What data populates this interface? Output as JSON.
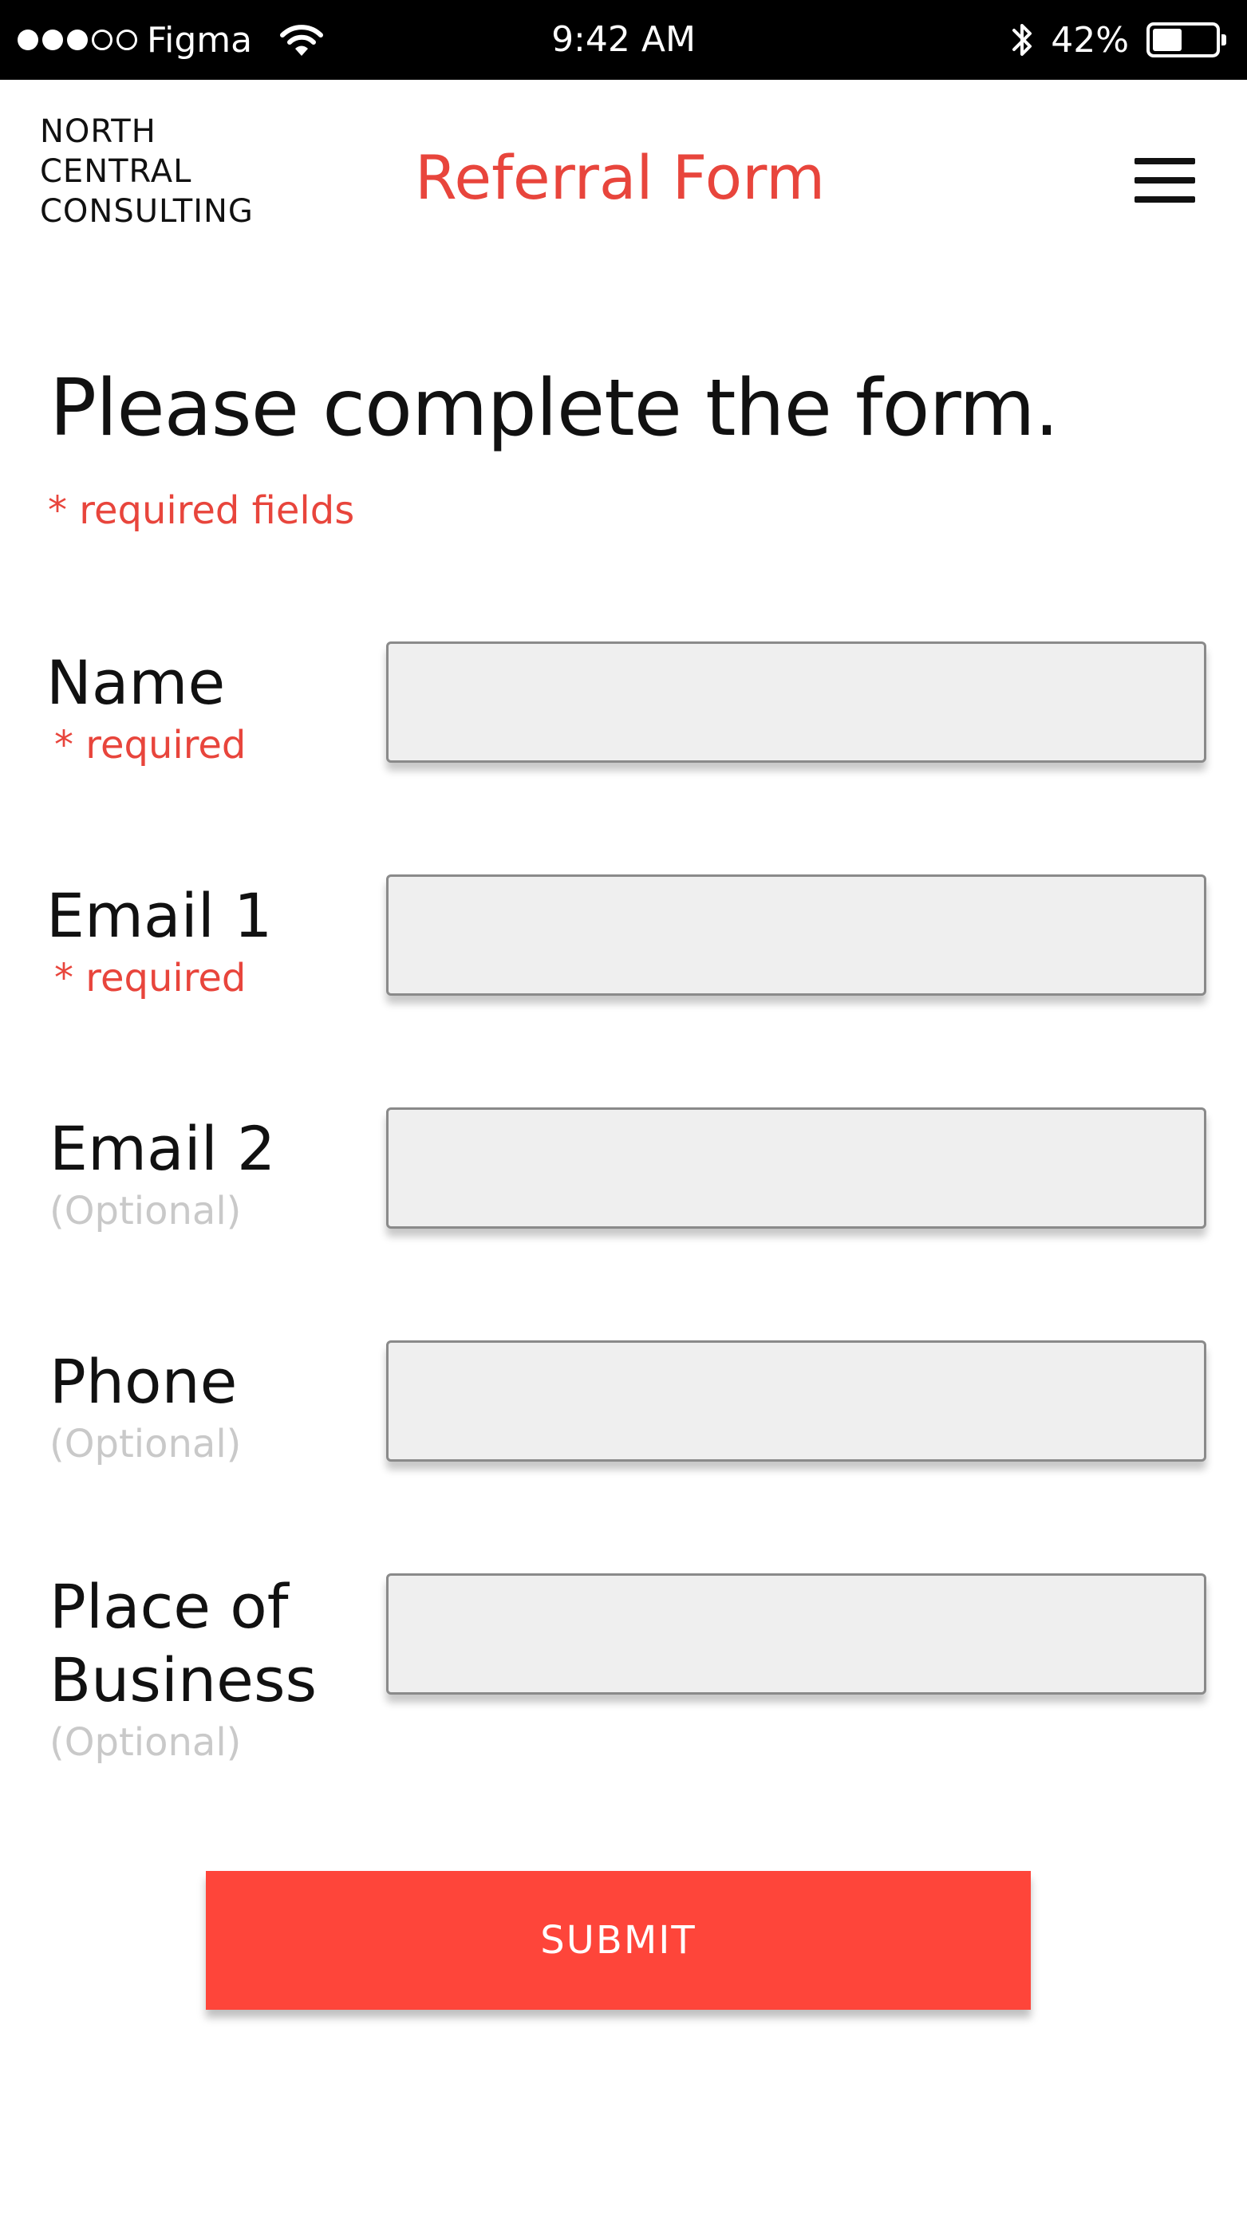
{
  "status_bar": {
    "carrier": "Figma",
    "time": "9:42 AM",
    "battery_percent": "42%",
    "battery_level": 0.42,
    "signal_bars_filled": 3,
    "signal_bars_total": 5
  },
  "header": {
    "brand_lines": [
      "NORTH",
      "CENTRAL",
      "CONSULTING"
    ],
    "title": "Referral Form",
    "menu_icon": "hamburger-menu-icon"
  },
  "form": {
    "heading": "Please complete the form.",
    "required_note": "* required fields",
    "fields": [
      {
        "label": "Name",
        "sub": "* required",
        "value": ""
      },
      {
        "label": "Email 1",
        "sub": "* required",
        "value": ""
      },
      {
        "label": "Email 2",
        "sub": "(Optional)",
        "value": ""
      },
      {
        "label": "Phone",
        "sub": "(Optional)",
        "value": ""
      },
      {
        "label_lines": [
          "Place of",
          "Business"
        ],
        "sub": "(Optional)",
        "value": ""
      }
    ],
    "submit_label": "SUBMIT"
  },
  "colors": {
    "accent": "#e8453c",
    "button": "#fe453a",
    "optional_text": "#c9c9c9",
    "input_bg": "#efefef"
  }
}
